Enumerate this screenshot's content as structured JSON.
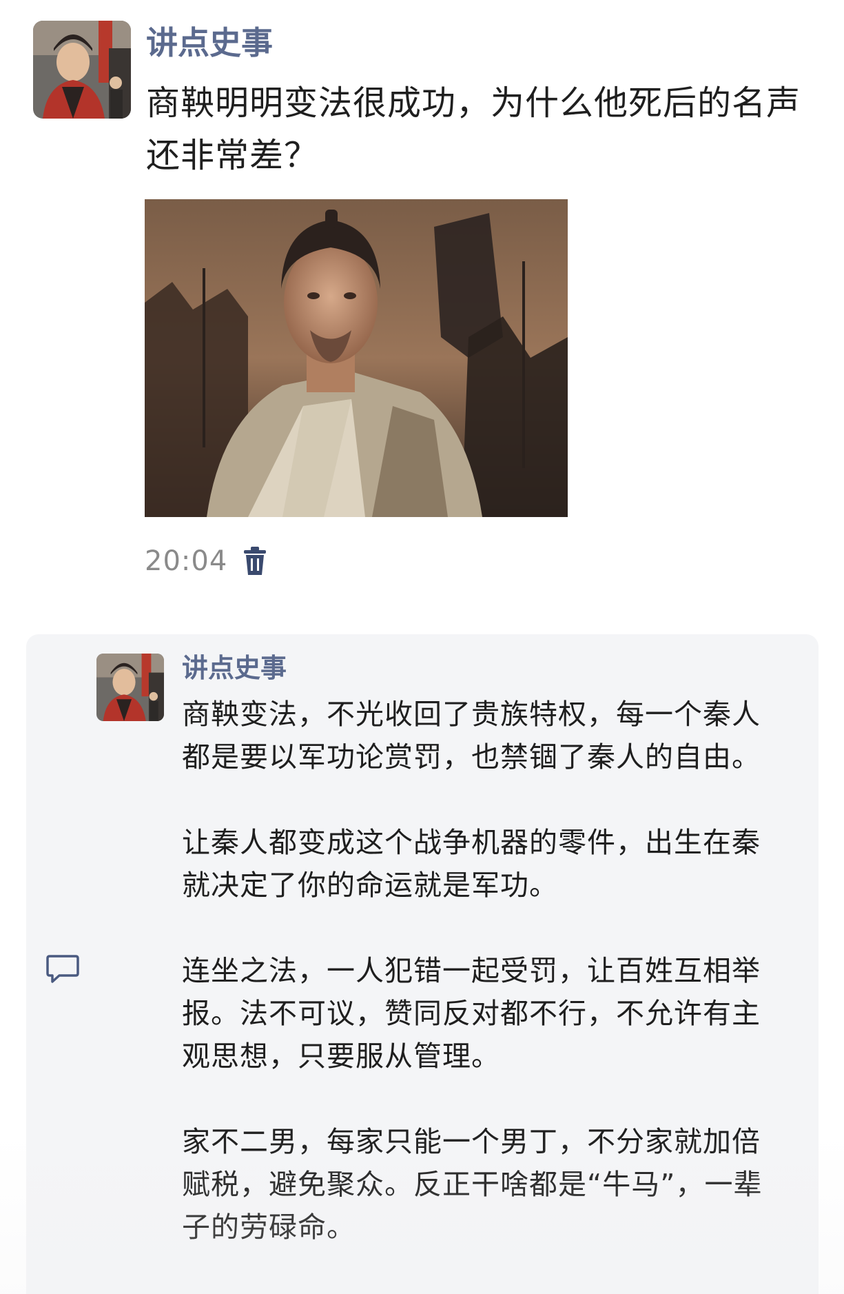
{
  "post": {
    "author": "讲点史事",
    "title": "商鞅明明变法很成功，为什么他死后的名声还非常差？",
    "time": "20:04",
    "avatar_icon": "avatar-portrait-icon",
    "delete_icon": "trash-icon"
  },
  "reply": {
    "author": "讲点史事",
    "paragraphs": [
      "商鞅变法，不光收回了贵族特权，每一个秦人都是要以军功论赏罚，也禁锢了秦人的自由。",
      "让秦人都变成这个战争机器的零件，出生在秦就决定了你的命运就是军功。",
      "连坐之法，一人犯错一起受罚，让百姓互相举报。法不可议，赞同反对都不行，不允许有主观思想，只要服从管理。",
      "家不二男，每家只能一个男丁，不分家就加倍赋税，避免聚众。反正干啥都是“牛马”，一辈子的劳碌命。"
    ],
    "comment_icon": "comment-icon"
  },
  "colors": {
    "author_name": "#5b6a8e",
    "text": "#1f1f1f",
    "meta": "#8a8a8a",
    "reply_bg": "#f4f5f7"
  }
}
